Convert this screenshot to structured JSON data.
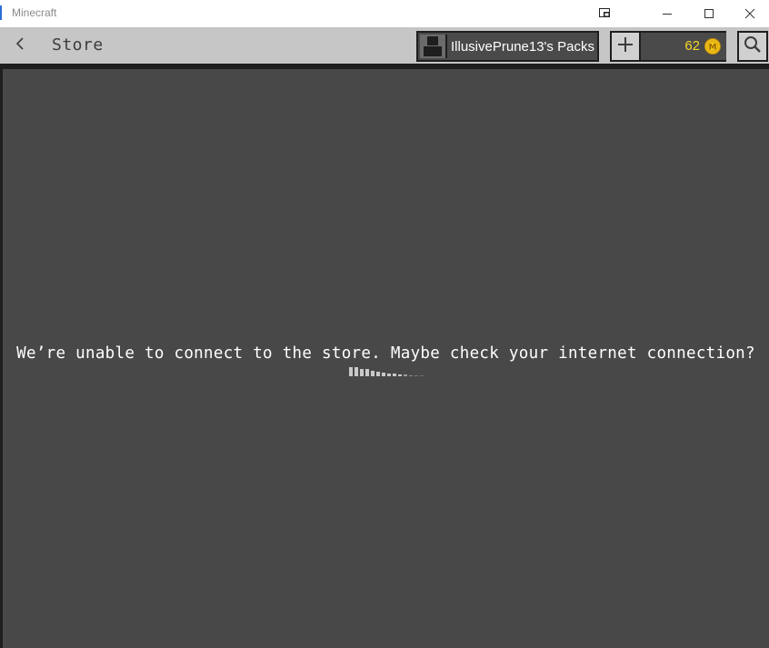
{
  "window": {
    "title": "Minecraft"
  },
  "header": {
    "back_icon": "chevron-left-icon",
    "title": "Store",
    "packs_label": "IllusivePrune13's Packs",
    "coins": "62",
    "coin_letter": "M"
  },
  "main": {
    "error_message": "We’re unable to connect to the store. Maybe check your internet connection?"
  },
  "colors": {
    "header_bg": "#c6c6c6",
    "content_bg": "#484848",
    "coin_text": "#f5d629",
    "coin_fill": "#f2c21a"
  }
}
